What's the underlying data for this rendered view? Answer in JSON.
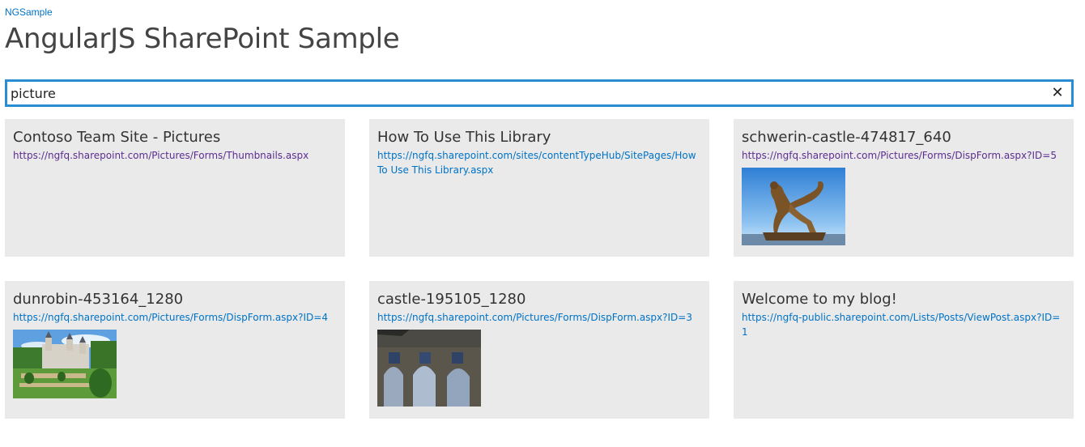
{
  "site": {
    "link_label": "NGSample"
  },
  "page": {
    "title": "AngularJS SharePoint Sample"
  },
  "search": {
    "value": "picture",
    "clear_glyph": "✕"
  },
  "results": [
    {
      "title": "Contoso Team Site - Pictures",
      "url": "https://ngfq.sharepoint.com/Pictures/Forms/Thumbnails.aspx",
      "visited": true,
      "thumbnail": null
    },
    {
      "title": "How To Use This Library",
      "url": "https://ngfq.sharepoint.com/sites/contentTypeHub/SitePages/How To Use This Library.aspx",
      "visited": false,
      "thumbnail": null
    },
    {
      "title": "schwerin-castle-474817_640",
      "url": "https://ngfq.sharepoint.com/Pictures/Forms/DispForm.aspx?ID=5",
      "visited": true,
      "thumbnail": "statue"
    },
    {
      "title": "dunrobin-453164_1280",
      "url": "https://ngfq.sharepoint.com/Pictures/Forms/DispForm.aspx?ID=4",
      "visited": false,
      "thumbnail": "castle-garden"
    },
    {
      "title": "castle-195105_1280",
      "url": "https://ngfq.sharepoint.com/Pictures/Forms/DispForm.aspx?ID=3",
      "visited": false,
      "thumbnail": "ruin"
    },
    {
      "title": "Welcome to my blog!",
      "url": "https://ngfq-public.sharepoint.com/Lists/Posts/ViewPost.aspx?ID=1",
      "visited": false,
      "thumbnail": null
    }
  ],
  "colors": {
    "link": "#0072c6",
    "visited_link": "#5c2d91",
    "search_border": "#2a8dd4",
    "card_background": "#eaeaea"
  }
}
